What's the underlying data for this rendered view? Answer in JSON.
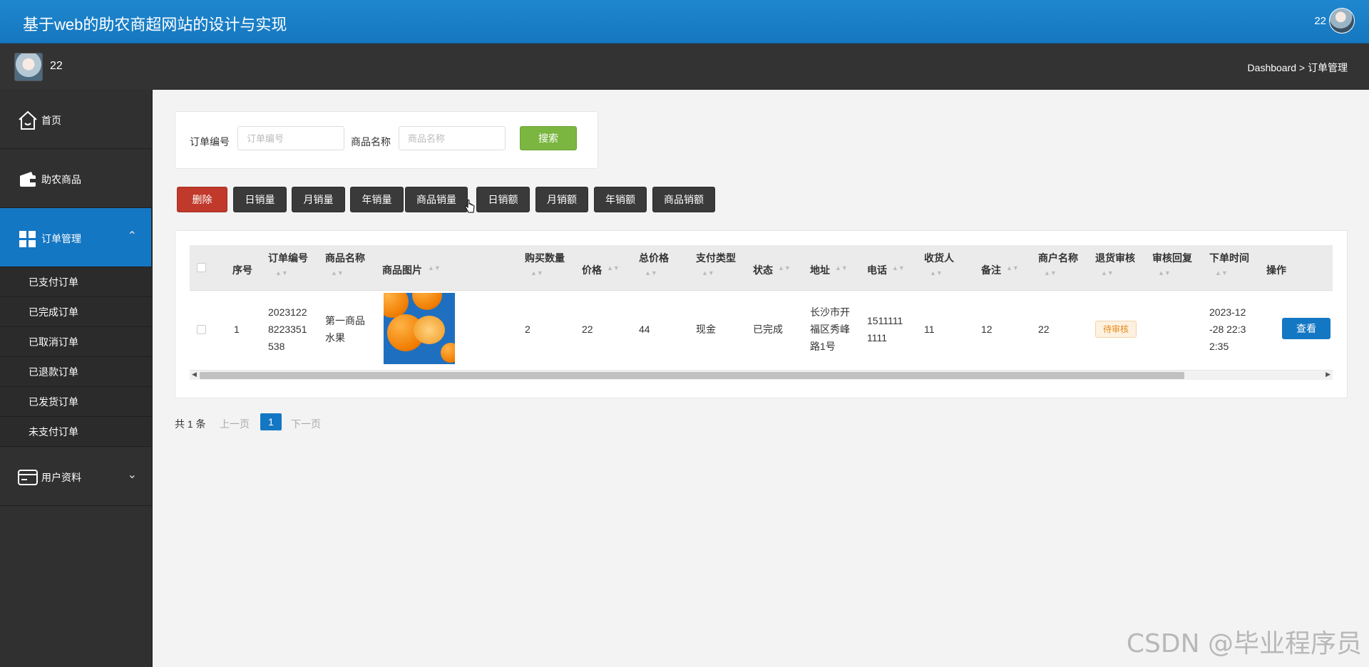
{
  "header": {
    "title": "基于web的助农商超网站的设计与实现",
    "username": "22"
  },
  "subheader": {
    "username": "22",
    "breadcrumb": "Dashboard > 订单管理"
  },
  "sidebar": {
    "items": [
      {
        "label": "首页",
        "icon": "home-icon"
      },
      {
        "label": "助农商品",
        "icon": "wallet-icon"
      },
      {
        "label": "订单管理",
        "icon": "grid-icon",
        "active": true,
        "expanded": true
      },
      {
        "label": "用户资料",
        "icon": "card-icon"
      }
    ],
    "submenu": [
      "已支付订单",
      "已完成订单",
      "已取消订单",
      "已退款订单",
      "已发货订单",
      "未支付订单"
    ]
  },
  "search": {
    "order_no_label": "订单编号",
    "order_no_placeholder": "订单编号",
    "product_label": "商品名称",
    "product_placeholder": "商品名称",
    "search_button": "搜索"
  },
  "toolbar": {
    "buttons": [
      "删除",
      "日销量",
      "月销量",
      "年销量",
      "商品销量",
      "日销额",
      "月销额",
      "年销额",
      "商品销额"
    ]
  },
  "table": {
    "columns": [
      "序号",
      "订单编号",
      "商品名称",
      "商品图片",
      "购买数量",
      "价格",
      "总价格",
      "支付类型",
      "状态",
      "地址",
      "电话",
      "收货人",
      "备注",
      "商户名称",
      "退货审核",
      "审核回复",
      "下单时间",
      "操作"
    ],
    "rows": [
      {
        "index": "1",
        "order_no_lines": [
          "2023122",
          "8223351",
          "538"
        ],
        "product_lines": [
          "第一商品",
          "水果"
        ],
        "quantity": "2",
        "price": "22",
        "total": "44",
        "pay_type": "现金",
        "status": "已完成",
        "address_lines": [
          "长沙市开",
          "福区秀峰",
          "路1号"
        ],
        "phone_lines": [
          "1511111",
          "1111"
        ],
        "receiver": "11",
        "remark": "12",
        "merchant": "22",
        "return_review": "待审核",
        "review_reply": "",
        "time_lines": [
          "2023-12",
          "-28 22:3",
          "2:35"
        ],
        "view_button": "查看"
      }
    ]
  },
  "pager": {
    "total": "共 1 条",
    "prev": "上一页",
    "current": "1",
    "next": "下一页"
  },
  "watermark": "CSDN @毕业程序员",
  "colors": {
    "primary": "#1477c4",
    "danger": "#c0392b",
    "success": "#7ab640",
    "sidebar": "#303030"
  }
}
